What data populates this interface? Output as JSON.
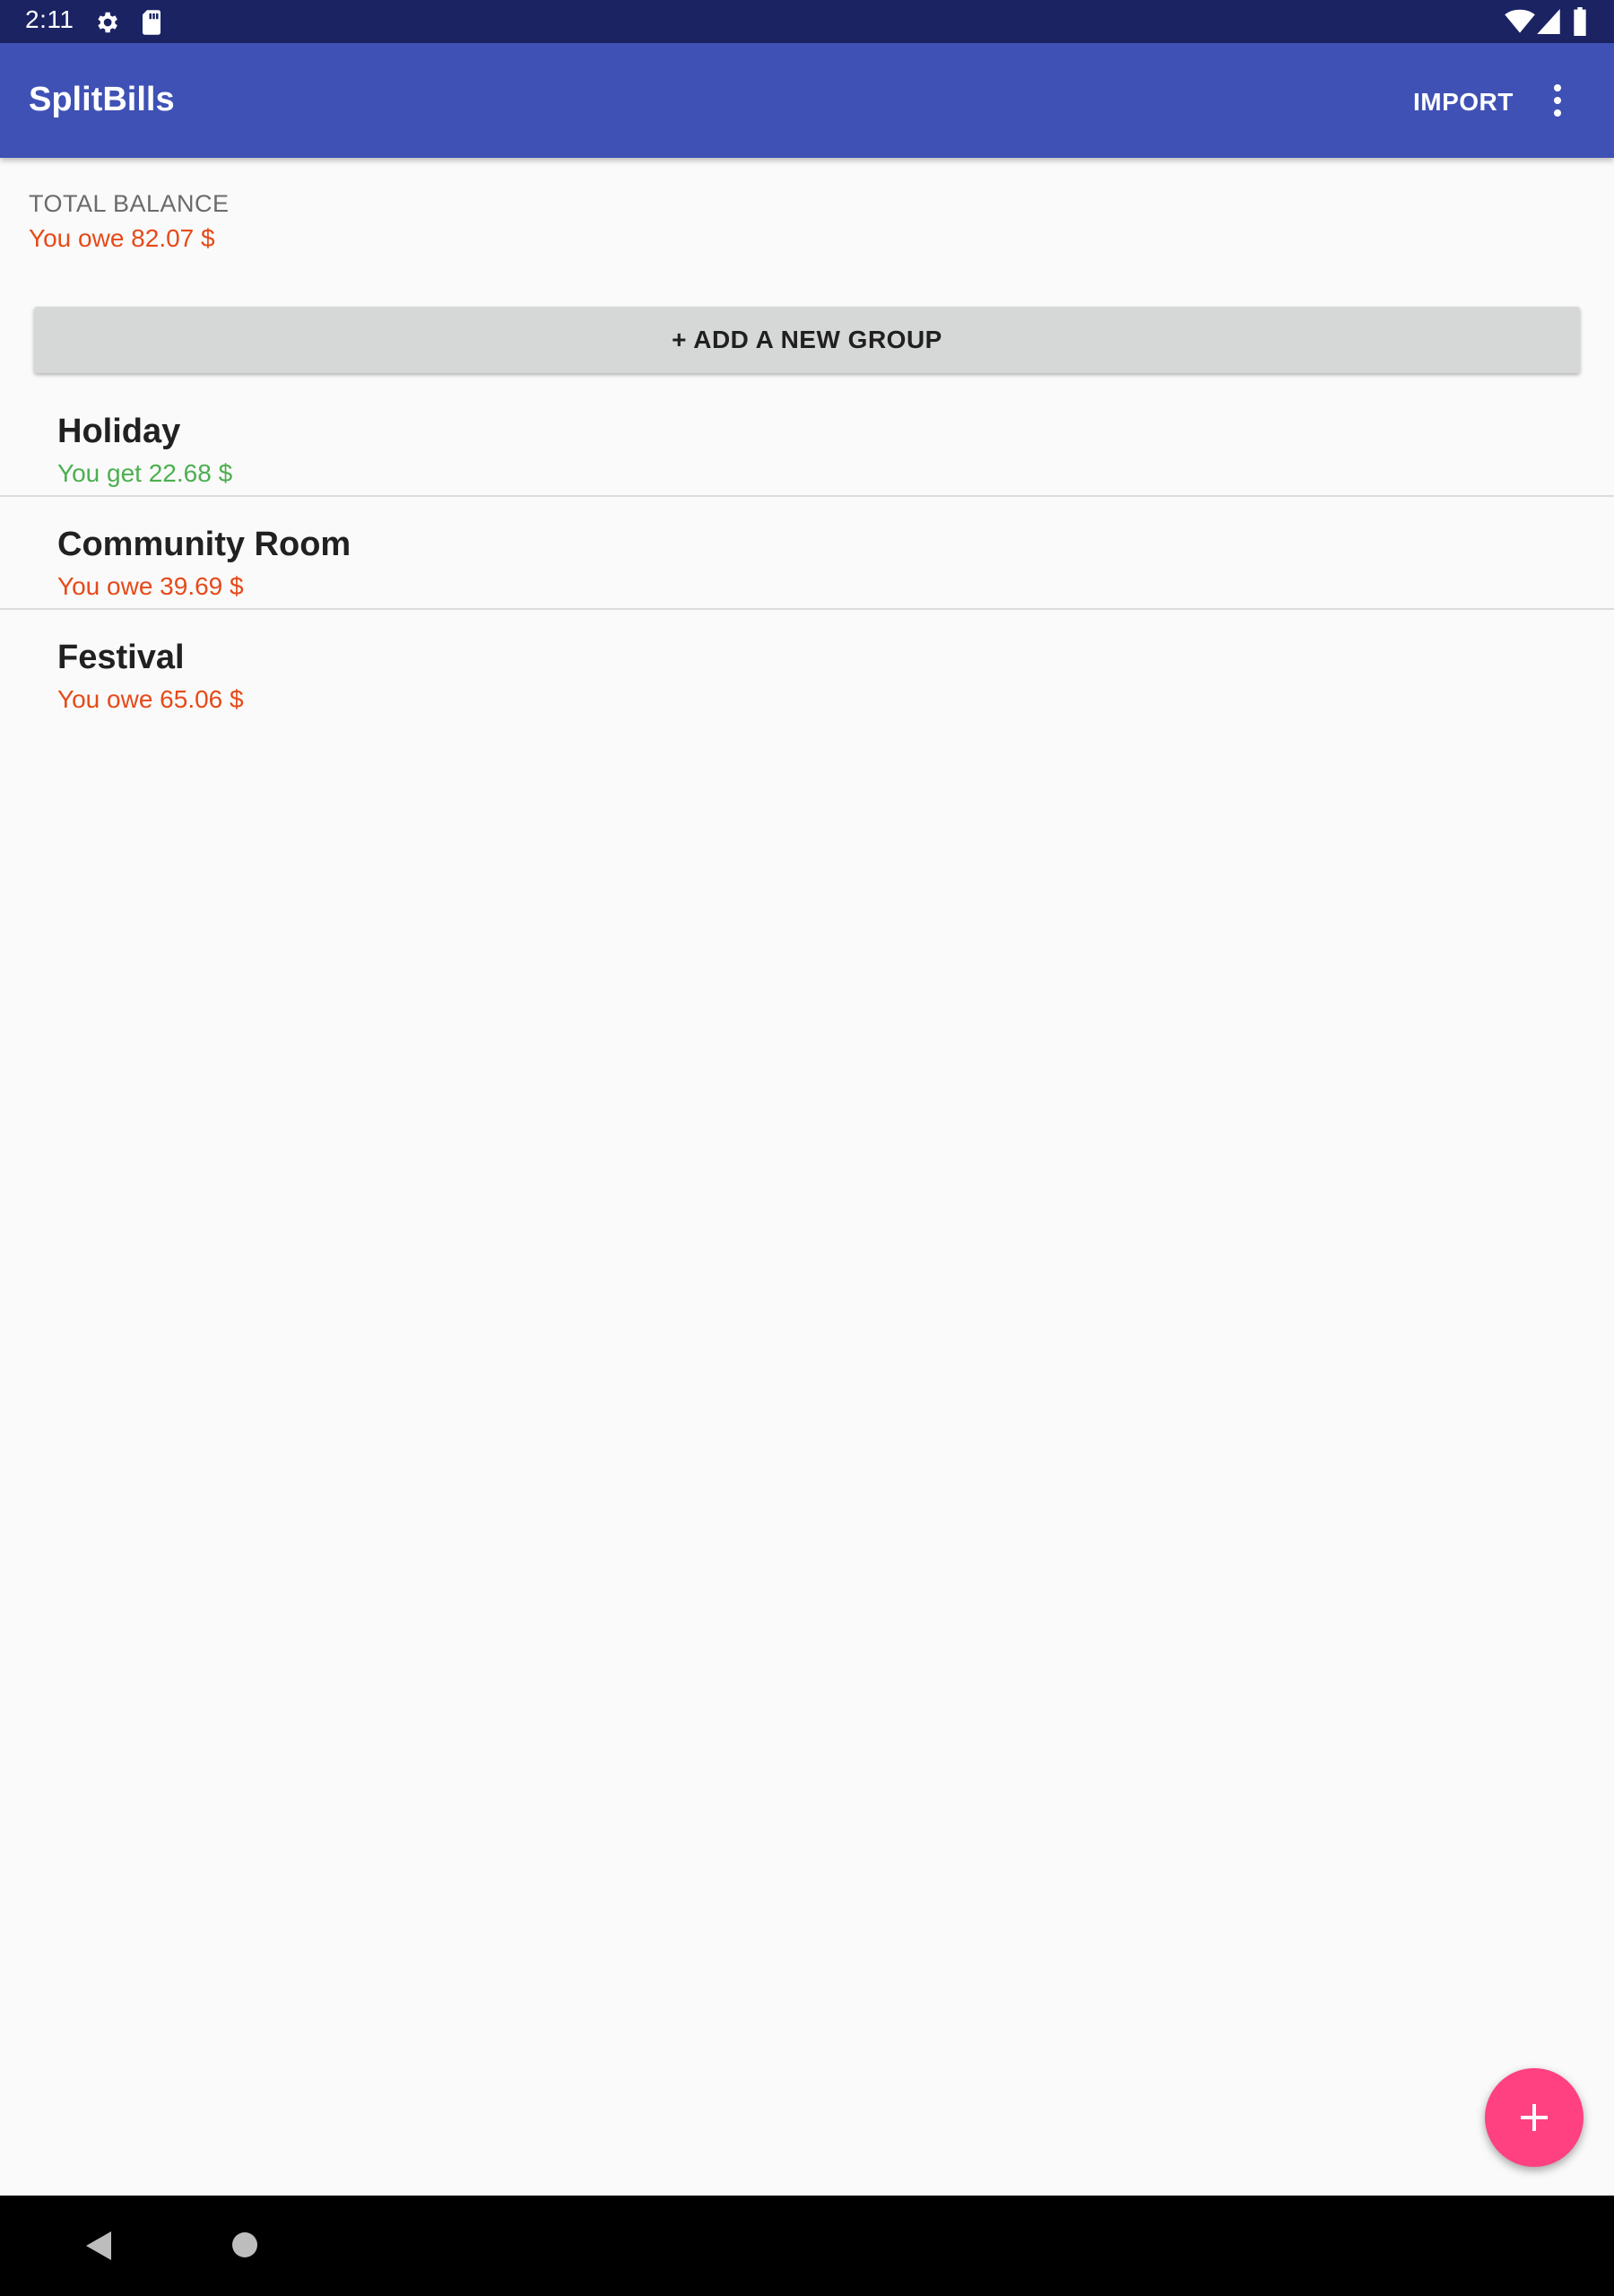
{
  "status_bar": {
    "time": "2:11",
    "icons": [
      "settings-icon",
      "sd-card-icon",
      "wifi-icon",
      "signal-icon",
      "battery-icon"
    ]
  },
  "app_bar": {
    "title": "SplitBills",
    "import_label": "IMPORT",
    "menu_icon": "more-vert-icon",
    "color": "#3f51b5"
  },
  "total_balance": {
    "label": "TOTAL BALANCE",
    "value": "You owe 82.07 $",
    "color": "#e64a19"
  },
  "add_group": {
    "label": "+ ADD A NEW GROUP"
  },
  "groups": [
    {
      "name": "Holiday",
      "balance": "You get 22.68 $",
      "color": "#4caf50"
    },
    {
      "name": "Community Room",
      "balance": "You owe 39.69 $",
      "color": "#e64a19"
    },
    {
      "name": "Festival",
      "balance": "You owe 65.06 $",
      "color": "#e64a19"
    }
  ],
  "fab": {
    "icon": "plus-icon",
    "color": "#ff4081"
  },
  "nav_bar": {
    "icons": [
      "back-icon",
      "home-icon"
    ]
  }
}
